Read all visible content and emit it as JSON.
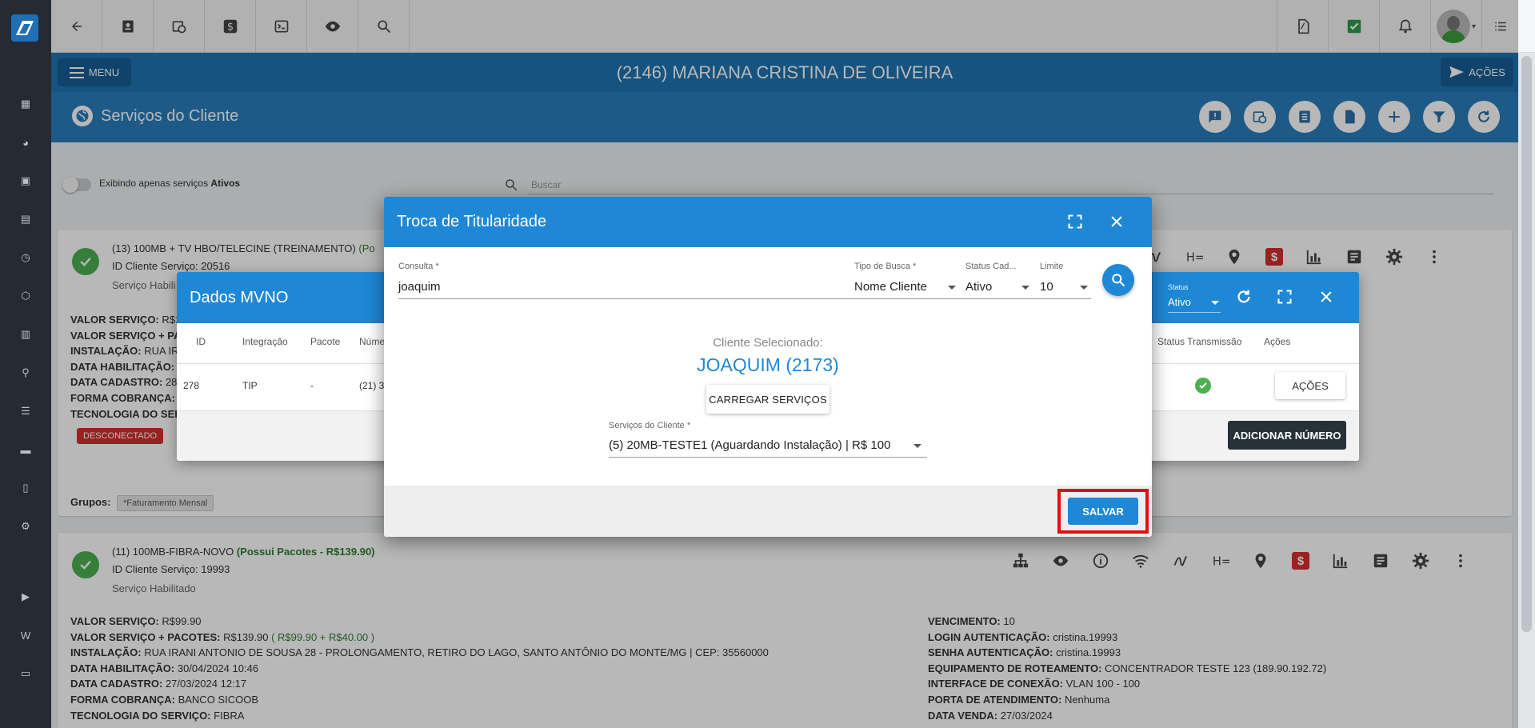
{
  "header": {
    "client_title": "(2146) MARIANA CRISTINA DE OLIVEIRA",
    "menu_label": "MENU",
    "acoes_label": "AÇÕES",
    "page_title": "Serviços do Cliente"
  },
  "filter": {
    "toggle_text": "Exibindo apenas serviços",
    "toggle_strong": "Ativos",
    "search_placeholder": "Buscar"
  },
  "service1": {
    "title": "(13) 100MB + TV HBO/TELECINE (TREINAMENTO)",
    "title_extra": "(Po",
    "id_line": "ID Cliente Serviço: 20516",
    "status": "Serviço Habili",
    "lines": [
      {
        "k": "VALOR SERVIÇO:",
        "v": "R$1"
      },
      {
        "k": "VALOR SERVIÇO + PA",
        "v": ""
      },
      {
        "k": "INSTALAÇÃO:",
        "v": "RUA IR"
      },
      {
        "k": "DATA HABILITAÇÃO:",
        "v": ""
      },
      {
        "k": "DATA CADASTRO:",
        "v": "28"
      },
      {
        "k": "FORMA COBRANÇA:",
        "v": ""
      },
      {
        "k": "TECNOLOGIA DO SER",
        "v": ""
      }
    ],
    "badge": "DESCONECTADO",
    "groups_label": "Grupos:",
    "group_chip": "*Faturamento Mensal"
  },
  "service2": {
    "title": "(11) 100MB-FIBRA-NOVO",
    "title_extra": "(Possui Pacotes - R$139.90)",
    "id_line": "ID Cliente Serviço: 19993",
    "status": "Serviço Habilitado",
    "left": [
      {
        "k": "VALOR SERVIÇO:",
        "v": "R$99.90",
        "g": ""
      },
      {
        "k": "VALOR SERVIÇO + PACOTES:",
        "v": "R$139.90",
        "g": "( R$99.90 + R$40.00 )"
      },
      {
        "k": "INSTALAÇÃO:",
        "v": "RUA IRANI ANTONIO DE SOUSA 28 - PROLONGAMENTO, RETIRO DO LAGO, SANTO ANTÔNIO DO MONTE/MG | CEP: 35560000",
        "g": ""
      },
      {
        "k": "DATA HABILITAÇÃO:",
        "v": "30/04/2024 10:46",
        "g": ""
      },
      {
        "k": "DATA CADASTRO:",
        "v": "27/03/2024 12:17",
        "g": ""
      },
      {
        "k": "FORMA COBRANÇA:",
        "v": "BANCO SICOOB",
        "g": ""
      },
      {
        "k": "TECNOLOGIA DO SERVIÇO:",
        "v": "FIBRA",
        "g": ""
      }
    ],
    "right": [
      {
        "k": "VENCIMENTO:",
        "v": "10"
      },
      {
        "k": "LOGIN AUTENTICAÇÃO:",
        "v": "cristina.19993"
      },
      {
        "k": "SENHA AUTENTICAÇÃO:",
        "v": "cristina.19993"
      },
      {
        "k": "EQUIPAMENTO DE ROTEAMENTO:",
        "v": "CONCENTRADOR TESTE 123 (189.90.192.72)"
      },
      {
        "k": "INTERFACE DE CONEXÃO:",
        "v": "VLAN 100 - 100"
      },
      {
        "k": "PORTA DE ATENDIMENTO:",
        "v": "Nenhuma"
      },
      {
        "k": "DATA VENDA:",
        "v": "27/03/2024"
      }
    ]
  },
  "mvno": {
    "title": "Dados MVNO",
    "status_label": "Status",
    "status_value": "Ativo",
    "columns": [
      "ID",
      "Integração",
      "Pacote",
      "Núme",
      "Status Transmissão",
      "Ações"
    ],
    "row": {
      "id": "278",
      "integracao": "TIP",
      "pacote": "-",
      "numero": "(21) 3"
    },
    "acoes_button": "AÇÕES",
    "add_button": "ADICIONAR NÚMERO"
  },
  "dialog": {
    "title": "Troca de Titularidade",
    "consulta_label": "Consulta *",
    "consulta_value": "joaquim",
    "tipo_label": "Tipo de Busca *",
    "tipo_value": "Nome Cliente",
    "status_label": "Status Cad...",
    "status_value": "Ativo",
    "limite_label": "Limite",
    "limite_value": "10",
    "selected_label": "Cliente Selecionado:",
    "selected_name": "JOAQUIM (2173)",
    "carregar_button": "CARREGAR SERVIÇOS",
    "servicos_label": "Serviços do Cliente *",
    "servicos_value": "(5) 20MB-TESTE1 (Aguardando Instalação) | R$ 100",
    "salvar_button": "SALVAR"
  },
  "colors": {
    "primary": "#1e88d6",
    "header": "#1f73b0",
    "rail": "#262b33",
    "danger": "#d32f2f",
    "success": "#4caf50"
  }
}
